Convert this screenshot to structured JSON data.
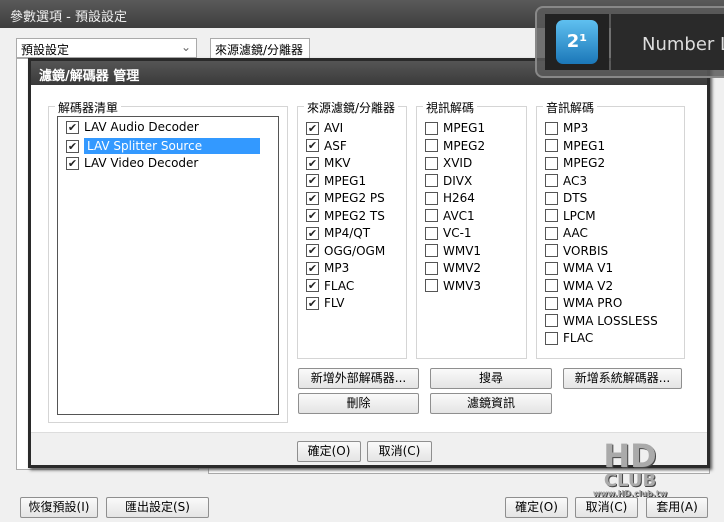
{
  "window": {
    "title": "參數選項 - 預設設定"
  },
  "preset_select": {
    "value": "預設設定"
  },
  "tab": {
    "label": "來源濾鏡/分離器"
  },
  "dialog": {
    "title": "濾鏡/解碼器 管理",
    "decoder_list": {
      "label": "解碼器清單",
      "items": [
        {
          "label": "LAV Audio Decoder",
          "checked": true,
          "selected": false
        },
        {
          "label": "LAV Splitter Source",
          "checked": true,
          "selected": true
        },
        {
          "label": "LAV Video Decoder",
          "checked": true,
          "selected": false
        }
      ]
    },
    "source": {
      "label": "來源濾鏡/分離器",
      "items": [
        {
          "label": "AVI",
          "checked": true
        },
        {
          "label": "ASF",
          "checked": true
        },
        {
          "label": "MKV",
          "checked": true
        },
        {
          "label": "MPEG1",
          "checked": true
        },
        {
          "label": "MPEG2 PS",
          "checked": true
        },
        {
          "label": "MPEG2 TS",
          "checked": true
        },
        {
          "label": "MP4/QT",
          "checked": true
        },
        {
          "label": "OGG/OGM",
          "checked": true
        },
        {
          "label": "MP3",
          "checked": true
        },
        {
          "label": "FLAC",
          "checked": true
        },
        {
          "label": "FLV",
          "checked": true
        }
      ]
    },
    "video": {
      "label": "視訊解碼",
      "items": [
        {
          "label": "MPEG1",
          "checked": false
        },
        {
          "label": "MPEG2",
          "checked": false
        },
        {
          "label": "XVID",
          "checked": false
        },
        {
          "label": "DIVX",
          "checked": false
        },
        {
          "label": "H264",
          "checked": false
        },
        {
          "label": "AVC1",
          "checked": false
        },
        {
          "label": "VC-1",
          "checked": false
        },
        {
          "label": "WMV1",
          "checked": false
        },
        {
          "label": "WMV2",
          "checked": false
        },
        {
          "label": "WMV3",
          "checked": false
        }
      ]
    },
    "audio": {
      "label": "音訊解碼",
      "items": [
        {
          "label": "MP3",
          "checked": false
        },
        {
          "label": "MPEG1",
          "checked": false
        },
        {
          "label": "MPEG2",
          "checked": false
        },
        {
          "label": "AC3",
          "checked": false
        },
        {
          "label": "DTS",
          "checked": false
        },
        {
          "label": "LPCM",
          "checked": false
        },
        {
          "label": "AAC",
          "checked": false
        },
        {
          "label": "VORBIS",
          "checked": false
        },
        {
          "label": "WMA V1",
          "checked": false
        },
        {
          "label": "WMA V2",
          "checked": false
        },
        {
          "label": "WMA PRO",
          "checked": false
        },
        {
          "label": "WMA LOSSLESS",
          "checked": false
        },
        {
          "label": "FLAC",
          "checked": false
        }
      ]
    },
    "buttons": {
      "add_external": "新增外部解碼器...",
      "search": "搜尋",
      "add_system": "新增系統解碼器...",
      "delete": "刪除",
      "filter_info": "濾鏡資訊",
      "ok": "確定(O)",
      "cancel": "取消(C)"
    }
  },
  "footer": {
    "restore": "恢復預設(I)",
    "export": "匯出設定(S)",
    "ok": "確定(O)",
    "cancel": "取消(C)",
    "apply": "套用(A)"
  },
  "overlay": {
    "text": "Number L"
  },
  "watermark": {
    "text": "HD CLUB www.HD.club.tw"
  },
  "colors": {
    "selection": "#3399ff",
    "titlebar": "#4a4a4a"
  }
}
